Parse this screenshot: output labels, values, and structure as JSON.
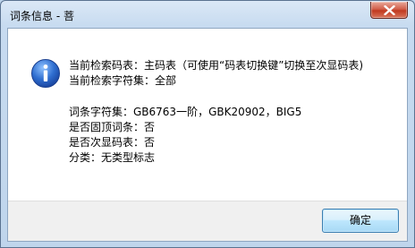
{
  "window": {
    "title": "词条信息 - 菩"
  },
  "dialog": {
    "lines": [
      "当前检索码表：主码表（可使用“码表切换键”切换至次显码表)",
      "当前检索字符集：全部",
      "词条字符集：GB6763一阶，GBK20902，BIG5",
      "是否固顶词条：否",
      "是否次显码表：否",
      "分类：无类型标志"
    ],
    "ok_label": "确定"
  },
  "icons": {
    "info": "info-icon",
    "close": "close-icon"
  },
  "colors": {
    "info_icon": "#2f6ed0",
    "close_button": "#c7402a",
    "ok_button_border": "#3c7fb1"
  }
}
